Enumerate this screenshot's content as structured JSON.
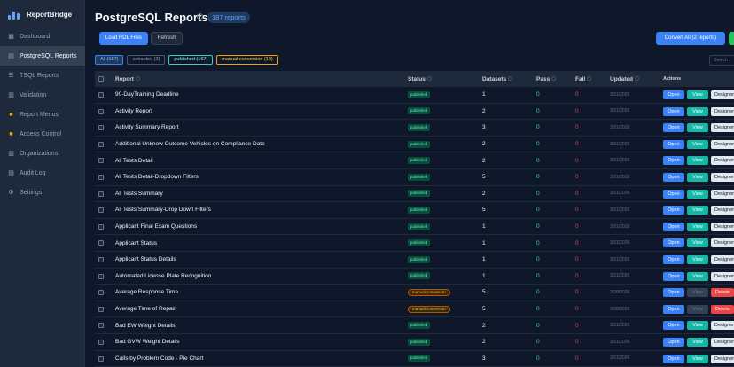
{
  "app": {
    "name": "ReportBridge"
  },
  "sidebar": {
    "items": [
      {
        "label": "Dashboard",
        "icon": "dashboard-icon",
        "glyph": "▦"
      },
      {
        "label": "PostgreSQL Reports",
        "icon": "database-icon",
        "glyph": "▤",
        "active": true
      },
      {
        "label": "TSQL Reports",
        "icon": "list-icon",
        "glyph": "☰"
      },
      {
        "label": "Validation",
        "icon": "checklist-icon",
        "glyph": "▥"
      },
      {
        "label": "Report Menus",
        "icon": "folder-icon",
        "glyph": "■"
      },
      {
        "label": "Access Control",
        "icon": "lock-icon",
        "glyph": "■"
      },
      {
        "label": "Organizations",
        "icon": "building-icon",
        "glyph": "▥"
      },
      {
        "label": "Audit Log",
        "icon": "log-icon",
        "glyph": "▤"
      },
      {
        "label": "Settings",
        "icon": "gear-icon",
        "glyph": "⚙"
      }
    ]
  },
  "header": {
    "title": "PostgreSQL Reports",
    "count": "187 reports",
    "load_label": "Load RDL Files",
    "refresh_label": "Refresh",
    "convert_label": "Convert All (2 reports)"
  },
  "filters": {
    "all": "All (187)",
    "extracted": "extracted (3)",
    "published": "published (167)",
    "manual": "manual conversion (18)",
    "search_placeholder": "Search"
  },
  "table": {
    "columns": [
      "Report",
      "Status",
      "Datasets",
      "Pass",
      "Fail",
      "Updated",
      "Actions"
    ],
    "action_labels": {
      "open": "Open",
      "view": "View",
      "designer": "Designer",
      "delete": "Delete"
    },
    "rows": [
      {
        "name": "90-DayTraining Deadline",
        "status": "published",
        "datasets": "1",
        "pass": "0",
        "fail": "0",
        "updated": "3/31/2026"
      },
      {
        "name": "Activity Report",
        "status": "published",
        "datasets": "2",
        "pass": "0",
        "fail": "0",
        "updated": "3/31/2026"
      },
      {
        "name": "Activity Summary Report",
        "status": "published",
        "datasets": "3",
        "pass": "0",
        "fail": "0",
        "updated": "3/31/2026"
      },
      {
        "name": "Additional Unknow Outcome Vehicles on Compliance Date",
        "status": "published",
        "datasets": "2",
        "pass": "0",
        "fail": "0",
        "updated": "3/31/2026"
      },
      {
        "name": "All Tests Detail",
        "status": "published",
        "datasets": "2",
        "pass": "0",
        "fail": "0",
        "updated": "3/31/2026"
      },
      {
        "name": "All Tests Detail-Dropdown Filters",
        "status": "published",
        "datasets": "5",
        "pass": "0",
        "fail": "0",
        "updated": "3/31/2026"
      },
      {
        "name": "All Tests Summary",
        "status": "published",
        "datasets": "2",
        "pass": "0",
        "fail": "0",
        "updated": "3/31/2026"
      },
      {
        "name": "All Tests Summary-Drop Down Filters",
        "status": "published",
        "datasets": "5",
        "pass": "0",
        "fail": "0",
        "updated": "3/31/2026"
      },
      {
        "name": "Applicant Final Exam Questions",
        "status": "published",
        "datasets": "1",
        "pass": "0",
        "fail": "0",
        "updated": "3/31/2026"
      },
      {
        "name": "Applicant Status",
        "status": "published",
        "datasets": "1",
        "pass": "0",
        "fail": "0",
        "updated": "3/31/2026"
      },
      {
        "name": "Applicant Status Details",
        "status": "published",
        "datasets": "1",
        "pass": "0",
        "fail": "0",
        "updated": "3/31/2026"
      },
      {
        "name": "Automated License Plate Recognition",
        "status": "published",
        "datasets": "1",
        "pass": "0",
        "fail": "0",
        "updated": "3/31/2026"
      },
      {
        "name": "Average Response Time",
        "status": "manual conversion",
        "datasets": "5",
        "pass": "0",
        "fail": "0",
        "updated": "3/28/2026"
      },
      {
        "name": "Average Time of Repair",
        "status": "manual conversion",
        "datasets": "5",
        "pass": "0",
        "fail": "0",
        "updated": "3/28/2026"
      },
      {
        "name": "Bad EW Weight Details",
        "status": "published",
        "datasets": "2",
        "pass": "0",
        "fail": "0",
        "updated": "3/31/2026"
      },
      {
        "name": "Bad GVW Weight Details",
        "status": "published",
        "datasets": "2",
        "pass": "0",
        "fail": "0",
        "updated": "3/31/2026"
      },
      {
        "name": "Calls by Problem Code - Pie Chart",
        "status": "published",
        "datasets": "3",
        "pass": "0",
        "fail": "0",
        "updated": "3/31/2026"
      }
    ]
  }
}
